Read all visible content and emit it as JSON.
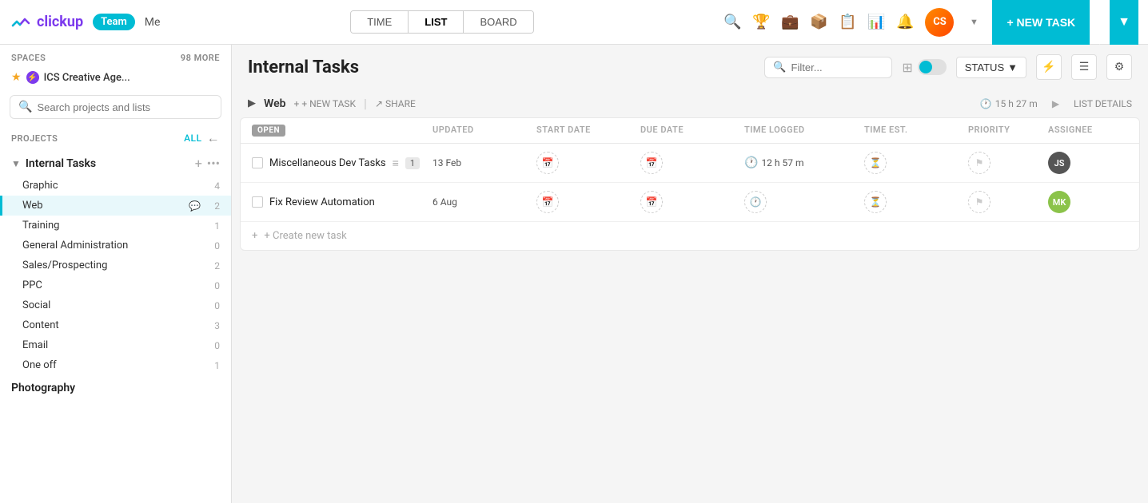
{
  "app": {
    "logo_text": "clickup",
    "team_label": "Team",
    "me_label": "Me"
  },
  "nav": {
    "tabs": [
      {
        "id": "time",
        "label": "TIME"
      },
      {
        "id": "list",
        "label": "LIST",
        "active": true
      },
      {
        "id": "board",
        "label": "BOARD"
      }
    ],
    "new_task_label": "+ NEW TASK",
    "avatar_initials": "CS"
  },
  "sidebar": {
    "spaces_label": "SPACES",
    "spaces_more": "98 more",
    "space_name": "ICS Creative Age...",
    "search_placeholder": "Search projects and lists",
    "projects_label": "PROJECTS",
    "projects_all": "All",
    "project_name": "Internal Tasks",
    "lists": [
      {
        "name": "Graphic",
        "count": "4",
        "active": false
      },
      {
        "name": "Web",
        "count": "2",
        "active": true
      },
      {
        "name": "Training",
        "count": "1",
        "active": false
      },
      {
        "name": "General Administration",
        "count": "0",
        "active": false
      },
      {
        "name": "Sales/Prospecting",
        "count": "2",
        "active": false
      },
      {
        "name": "PPC",
        "count": "0",
        "active": false
      },
      {
        "name": "Social",
        "count": "0",
        "active": false
      },
      {
        "name": "Content",
        "count": "3",
        "active": false
      },
      {
        "name": "Email",
        "count": "0",
        "active": false
      },
      {
        "name": "One off",
        "count": "1",
        "active": false
      }
    ],
    "photography_label": "Photography"
  },
  "content": {
    "page_title": "Internal Tasks",
    "filter_placeholder": "Filter...",
    "status_label": "STATUS",
    "section_name": "Web",
    "new_task_label": "+ NEW TASK",
    "share_label": "SHARE",
    "time_logged": "15 h 27 m",
    "list_details_label": "LIST DETAILS",
    "open_badge": "OPEN",
    "columns": {
      "updated": "UPDATED",
      "start_date": "START DATE",
      "due_date": "DUE DATE",
      "time_logged": "TIME LOGGED",
      "time_est": "TIME EST.",
      "priority": "PRIORITY",
      "assignee": "ASSIGNEE"
    },
    "tasks": [
      {
        "name": "Miscellaneous Dev Tasks",
        "badge": "1",
        "updated": "13 Feb",
        "time_logged": "12 h 57 m"
      },
      {
        "name": "Fix Review Automation",
        "badge": "",
        "updated": "6 Aug",
        "time_logged": ""
      }
    ],
    "create_label": "+ Create new task"
  }
}
